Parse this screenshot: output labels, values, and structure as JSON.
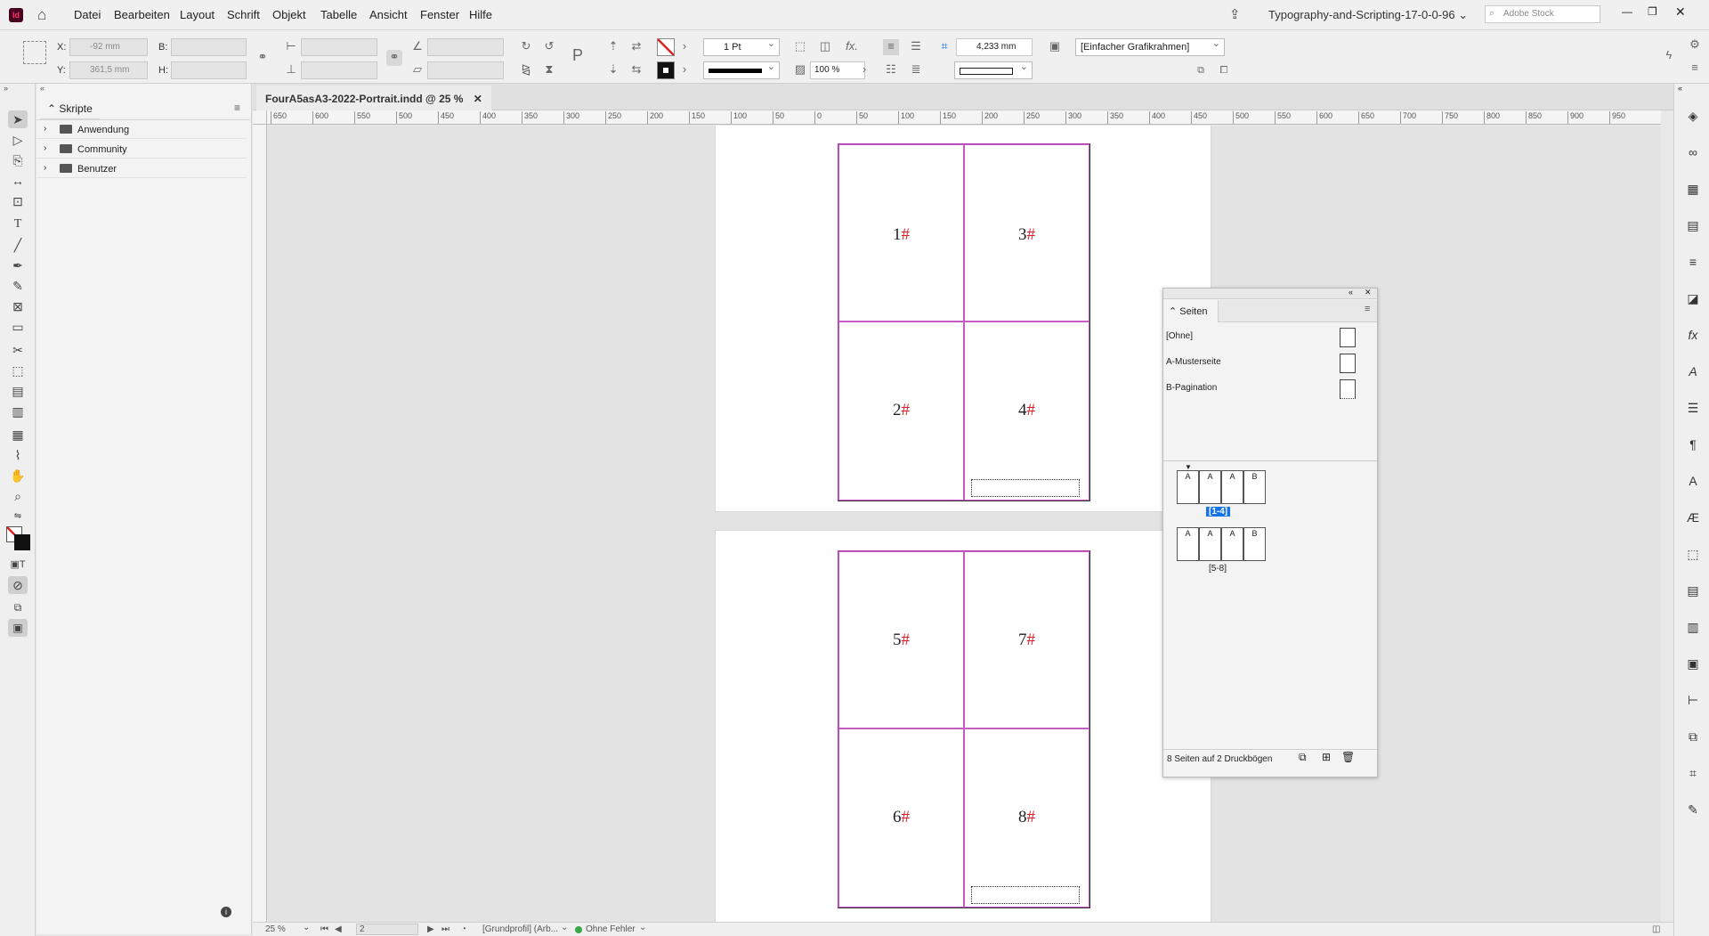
{
  "menubar": {
    "app_badge": "Id",
    "items": [
      "Datei",
      "Bearbeiten",
      "Layout",
      "Schrift",
      "Objekt",
      "Tabelle",
      "Ansicht",
      "Fenster",
      "Hilfe"
    ],
    "workspace": "Typography-and-Scripting-17-0-0-96",
    "search_placeholder": "Adobe Stock"
  },
  "control": {
    "x_label": "X:",
    "x_value": "-92 mm",
    "y_label": "Y:",
    "y_value": "361,5 mm",
    "b_label": "B:",
    "h_label": "H:",
    "stroke_weight": "1 Pt",
    "scale": "100 %",
    "frame_value": "4,233 mm",
    "object_style": "[Einfacher Grafikrahmen]"
  },
  "scripts_panel": {
    "title": "Skripte",
    "folders": [
      "Anwendung",
      "Community",
      "Benutzer"
    ]
  },
  "document": {
    "tab": "FourA5asA3-2022-Portrait.indd @ 25 %",
    "ruler_labels": [
      "650",
      "600",
      "550",
      "500",
      "450",
      "400",
      "350",
      "300",
      "250",
      "200",
      "150",
      "100",
      "50",
      "0",
      "50",
      "100",
      "150",
      "200",
      "250",
      "300",
      "350",
      "400",
      "450",
      "500",
      "550",
      "600",
      "650",
      "700",
      "750",
      "800",
      "850",
      "900",
      "950"
    ],
    "spread1": [
      {
        "n": "1",
        "h": "#"
      },
      {
        "n": "3",
        "h": "#"
      },
      {
        "n": "2",
        "h": "#"
      },
      {
        "n": "4",
        "h": "#"
      }
    ],
    "spread2": [
      {
        "n": "5",
        "h": "#"
      },
      {
        "n": "7",
        "h": "#"
      },
      {
        "n": "6",
        "h": "#"
      },
      {
        "n": "8",
        "h": "#"
      }
    ]
  },
  "pages_panel": {
    "title": "Seiten",
    "masters": [
      "[Ohne]",
      "A-Musterseite",
      "B-Pagination"
    ],
    "spread1_thumbs": [
      "A",
      "A",
      "A",
      "B"
    ],
    "spread1_label": "[1-4]",
    "spread2_thumbs": [
      "A",
      "A",
      "A",
      "B"
    ],
    "spread2_label": "[5-8]",
    "footer": "8 Seiten auf 2 Druckbögen"
  },
  "status": {
    "zoom": "25 %",
    "page": "2",
    "profile": "[Grundprofil] (Arb...",
    "errors": "Ohne Fehler"
  },
  "colors": {
    "accent": "#1473e6",
    "margin": "#c45cc4",
    "error_ok": "#3aa848",
    "marker": "#d9202a"
  }
}
